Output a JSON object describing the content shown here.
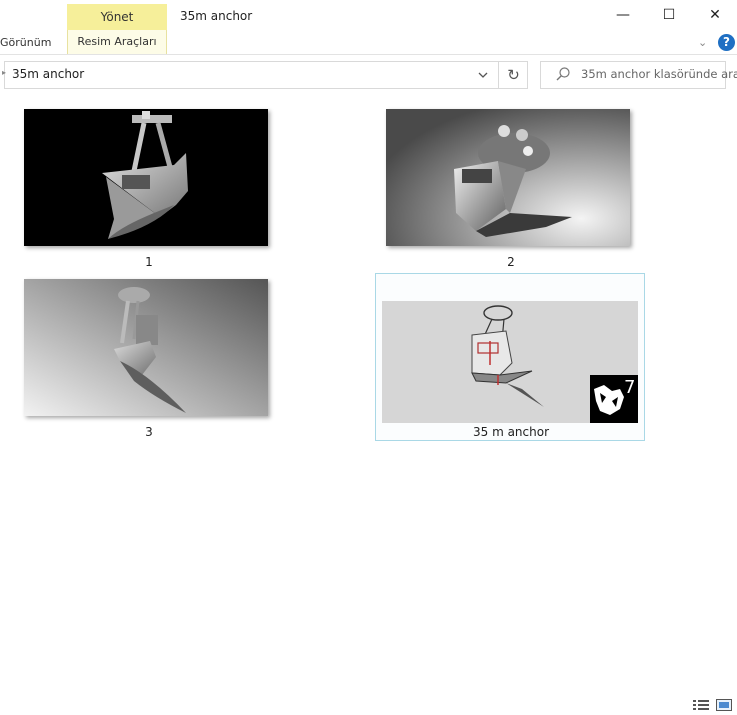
{
  "ribbon": {
    "contextual_tab": "Yönet",
    "contextual_subtab": "Resim Araçları",
    "view_tab": "Görünüm"
  },
  "window": {
    "title": "35m anchor",
    "controls": [
      "—",
      "☐",
      "✕"
    ]
  },
  "address_bar": {
    "path": "35m anchor"
  },
  "search": {
    "placeholder": "35m anchor klasöründe ara"
  },
  "files": [
    {
      "name": "1"
    },
    {
      "name": "2"
    },
    {
      "name": "3"
    },
    {
      "name": "35 m anchor"
    }
  ],
  "colors": {
    "manage_tab_bg": "#f6ef9a",
    "help_icon": "#1f6fc3",
    "selection_border": "#a9d8e6"
  },
  "icons": [
    "minimize-icon",
    "maximize-icon",
    "close-icon",
    "chevron-down-icon",
    "help-icon",
    "refresh-icon",
    "search-icon",
    "details-view-icon",
    "large-icons-view-icon"
  ]
}
